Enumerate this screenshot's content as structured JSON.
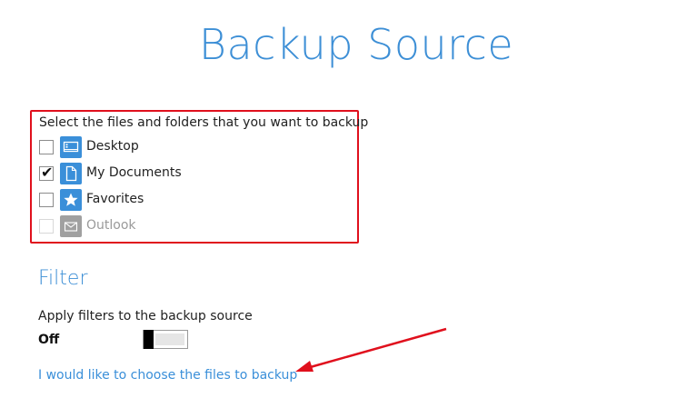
{
  "page": {
    "title": "Backup Source"
  },
  "source": {
    "instructions": "Select the files and folders that you want to backup",
    "items": [
      {
        "label": "Desktop",
        "checked": false,
        "enabled": true,
        "icon": "desktop-icon"
      },
      {
        "label": "My Documents",
        "checked": true,
        "enabled": true,
        "icon": "document-icon"
      },
      {
        "label": "Favorites",
        "checked": false,
        "enabled": true,
        "icon": "star-icon"
      },
      {
        "label": "Outlook",
        "checked": false,
        "enabled": false,
        "icon": "mail-icon"
      }
    ],
    "highlight_color": "#e0101d"
  },
  "filter": {
    "heading": "Filter",
    "description": "Apply filters to the backup source",
    "toggle_state": "Off",
    "toggle_on": false
  },
  "link": {
    "choose_files": "I would like to choose the files to backup"
  },
  "colors": {
    "accent": "#3d8fd6",
    "icon_blue": "#3a8fd9",
    "annotation_red": "#e0101d"
  }
}
